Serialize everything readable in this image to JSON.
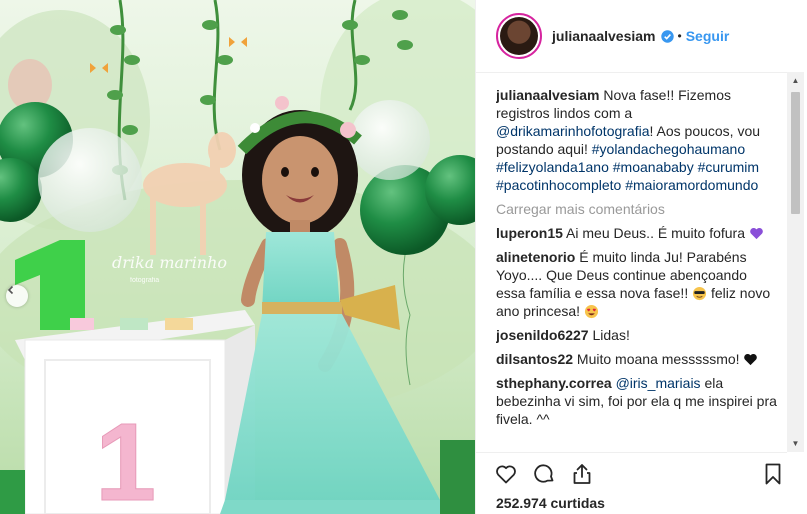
{
  "header": {
    "username": "julianaalvesiam",
    "follow_label": "Seguir",
    "separator": "•"
  },
  "photo": {
    "watermark": "drika marinho",
    "watermark_sub": "fotografia",
    "number": "1"
  },
  "caption": {
    "username": "julianaalvesiam",
    "text1": "Nova fase!! Fizemos registros lindos com a",
    "mention": "@drikamarinhofotografia",
    "text2": "! Aos poucos, vou postando aqui!",
    "hashtags": [
      "#yolandachegohaumano",
      "#felizyolanda1ano",
      "#moanababy",
      "#curumim",
      "#pacotinhocompleto",
      "#maioramordomundo"
    ]
  },
  "load_more": "Carregar mais comentários",
  "comments": [
    {
      "username": "luperon15",
      "text": "Ai meu Deus.. É muito fofura",
      "emoji": "purple-heart"
    },
    {
      "username": "alinetenorio",
      "text": "É muito linda Ju! Parabéns Yoyo.... Que Deus continue abençoando essa família e essa nova fase!!",
      "emoji": "sunglasses-face",
      "text_after": "feliz novo ano princesa!",
      "emoji2": "heart-eyes-face"
    },
    {
      "username": "josenildo6227",
      "text": "Lidas!"
    },
    {
      "username": "dilsantos22",
      "text": "Muito moana messsssmo!",
      "emoji": "black-heart"
    },
    {
      "username": "sthephany.correa",
      "mention": "@iris_mariais",
      "text": "ela bebezinha vi sim, foi por ela q me inspirei pra fivela. ^^"
    }
  ],
  "likes": "252.974 curtidas",
  "colors": {
    "accent_blue": "#3897f0",
    "link_dark": "#003569",
    "muted": "#999999",
    "text": "#262626"
  }
}
